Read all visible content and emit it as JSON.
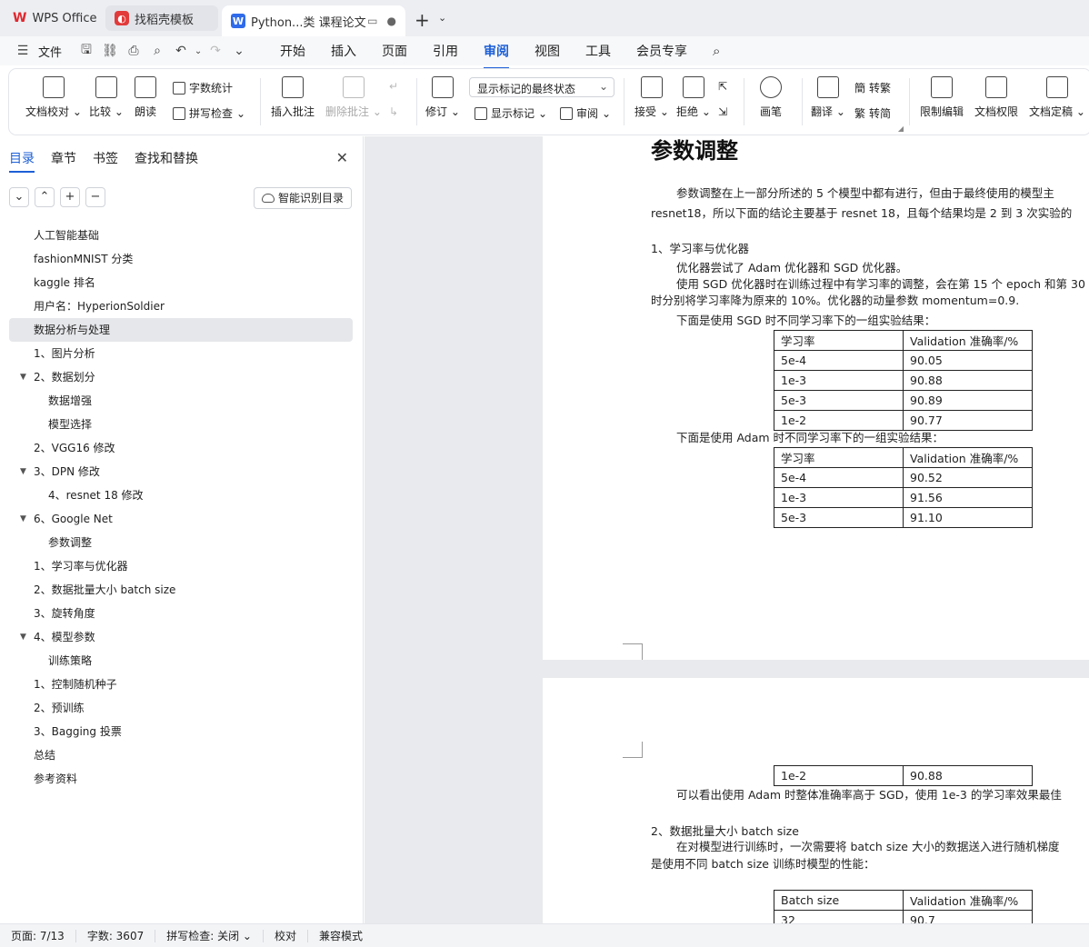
{
  "tabs": [
    {
      "label": "WPS Office"
    },
    {
      "label": "找稻壳模板"
    },
    {
      "label": "Python...类 课程论文"
    }
  ],
  "menubar": {
    "file_label": "文件",
    "tabs": [
      "开始",
      "插入",
      "页面",
      "引用",
      "审阅",
      "视图",
      "工具",
      "会员专享"
    ],
    "active_tab": "审阅"
  },
  "ribbon": {
    "doc_proof": "文档校对",
    "compare": "比较",
    "read_aloud": "朗读",
    "word_count": "字数统计",
    "spell_check": "拼写检查",
    "insert_comment": "插入批注",
    "delete_comment": "删除批注",
    "revise": "修订",
    "markup_select": "显示标记的最终状态",
    "show_markup": "显示标记",
    "review": "审阅",
    "accept": "接受",
    "reject": "拒绝",
    "pen": "画笔",
    "translate": "翻译",
    "to_traditional": "转繁",
    "to_simplified": "转简",
    "restrict_edit": "限制编辑",
    "doc_permission": "文档权限",
    "doc_finalize": "文档定稿"
  },
  "leftpane": {
    "tabs": [
      "目录",
      "章节",
      "书签",
      "查找和替换"
    ],
    "smart_toc": "智能识别目录",
    "toc": [
      {
        "label": "人工智能基础",
        "level": 1
      },
      {
        "label": "fashionMNIST 分类",
        "level": 1
      },
      {
        "label": "kaggle 排名",
        "level": 1
      },
      {
        "label": "用户名：HyperionSoldier",
        "level": 1
      },
      {
        "label": "数据分析与处理",
        "level": 1,
        "selected": true
      },
      {
        "label": "1、图片分析",
        "level": 1
      },
      {
        "label": "2、数据划分",
        "level": 1,
        "expanded": true
      },
      {
        "label": "数据增强",
        "level": 2
      },
      {
        "label": "模型选择",
        "level": 2
      },
      {
        "label": "2、VGG16 修改",
        "level": 1
      },
      {
        "label": "3、DPN 修改",
        "level": 1,
        "expanded": true
      },
      {
        "label": "4、resnet 18 修改",
        "level": 2
      },
      {
        "label": "6、Google Net",
        "level": 1,
        "expanded": true
      },
      {
        "label": "参数调整",
        "level": 2
      },
      {
        "label": "1、学习率与优化器",
        "level": 1
      },
      {
        "label": "2、数据批量大小 batch size",
        "level": 1
      },
      {
        "label": "3、旋转角度",
        "level": 1
      },
      {
        "label": "4、模型参数",
        "level": 1,
        "expanded": true
      },
      {
        "label": "训练策略",
        "level": 2
      },
      {
        "label": "1、控制随机种子",
        "level": 1
      },
      {
        "label": "2、预训练",
        "level": 1
      },
      {
        "label": "3、Bagging 投票",
        "level": 1
      },
      {
        "label": "总结",
        "level": 1
      },
      {
        "label": "参考资料",
        "level": 1
      }
    ]
  },
  "document": {
    "heading": "参数调整",
    "p1_line1": "参数调整在上一部分所述的 5 个模型中都有进行，但由于最终使用的模型主",
    "p1_line2": "resnet18，所以下面的结论主要基于 resnet 18，且每个结果均是 2 到 3 次实验的",
    "sec1_title": "1、学习率与优化器",
    "sec1_line1": "优化器尝试了 Adam 优化器和 SGD 优化器。",
    "sec1_line2": "使用 SGD 优化器时在训练过程中有学习率的调整，会在第 15 个 epoch 和第 30",
    "sec1_line3": "时分别将学习率降为原来的 10%。优化器的动量参数 momentum=0.9.",
    "sgd_caption": "下面是使用 SGD 时不同学习率下的一组实验结果：",
    "sgd_table": {
      "header": [
        "学习率",
        "Validation 准确率/%"
      ],
      "rows": [
        [
          "5e-4",
          "90.05"
        ],
        [
          "1e-3",
          "90.88"
        ],
        [
          "5e-3",
          "90.89"
        ],
        [
          "1e-2",
          "90.77"
        ]
      ]
    },
    "adam_caption": "下面是使用 Adam 时不同学习率下的一组实验结果：",
    "adam_table": {
      "header": [
        "学习率",
        "Validation 准确率/%"
      ],
      "rows": [
        [
          "5e-4",
          "90.52"
        ],
        [
          "1e-3",
          "91.56"
        ],
        [
          "5e-3",
          "91.10"
        ]
      ]
    },
    "adam_table_cont": [
      [
        "1e-2",
        "90.88"
      ]
    ],
    "conclusion": "可以看出使用 Adam 时整体准确率高于 SGD，使用 1e-3 的学习率效果最佳",
    "sec2_title": "2、数据批量大小 batch size",
    "sec2_line1": "在对模型进行训练时，一次需要将 batch size 大小的数据送入进行随机梯度",
    "sec2_line2": "是使用不同 batch size 训练时模型的性能：",
    "bs_table": {
      "header": [
        "Batch size",
        "Validation 准确率/%"
      ],
      "rows": [
        [
          "32",
          "90.7"
        ]
      ]
    }
  },
  "statusbar": {
    "page": "页面: 7/13",
    "words": "字数: 3607",
    "spell": "拼写检查: 关闭",
    "proof": "校对",
    "compat": "兼容模式"
  },
  "colors": {
    "accent": "#1c5fd6",
    "selected_toc": "#e6e7ea",
    "doc_bg": "#e9eaed"
  }
}
